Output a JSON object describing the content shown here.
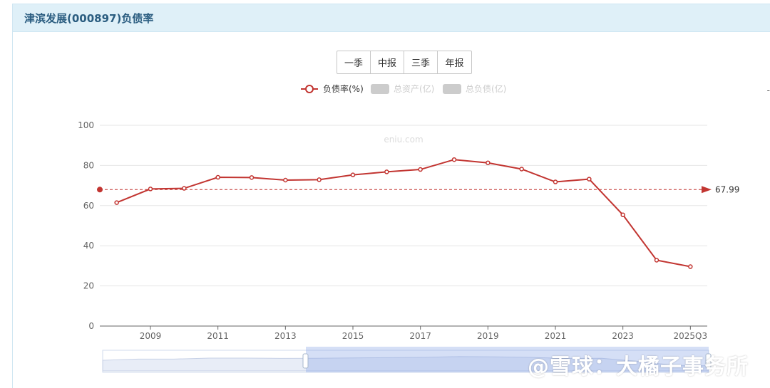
{
  "header": {
    "title": "津滨发展(000897)负债率"
  },
  "tabs": [
    {
      "label": "一季"
    },
    {
      "label": "中报"
    },
    {
      "label": "三季"
    },
    {
      "label": "年报"
    }
  ],
  "edge_mark": "-",
  "watermark": "@雪球：大橘子事务所",
  "colors": {
    "line": "#c23531",
    "grid": "#e6e6e6",
    "legend_inactive": "#cccccc"
  },
  "chart_data": {
    "type": "line",
    "legend": [
      {
        "name": "负债率(%)",
        "active": true
      },
      {
        "name": "总资产(亿)",
        "active": false
      },
      {
        "name": "总负债(亿)",
        "active": false
      }
    ],
    "source_mark": "eniu.com",
    "x": [
      "2008",
      "2009",
      "2010",
      "2011",
      "2012",
      "2013",
      "2014",
      "2015",
      "2016",
      "2017",
      "2018",
      "2019",
      "2020",
      "2021",
      "2022",
      "2023",
      "2024",
      "2025Q3"
    ],
    "x_tick_labels": [
      "2009",
      "2011",
      "2013",
      "2015",
      "2017",
      "2019",
      "2021",
      "2023",
      "2025Q3"
    ],
    "series": [
      {
        "name": "负债率(%)",
        "values": [
          61.5,
          68.3,
          68.6,
          74.1,
          74.0,
          72.7,
          72.9,
          75.3,
          76.8,
          78.0,
          82.9,
          81.3,
          78.2,
          71.8,
          73.2,
          55.4,
          32.8,
          29.6
        ]
      }
    ],
    "mark_line": {
      "value": 67.99,
      "label": "67.99"
    },
    "ylim": [
      0,
      100
    ],
    "y_ticks": [
      0,
      20,
      40,
      60,
      80,
      100
    ],
    "grid": true
  }
}
